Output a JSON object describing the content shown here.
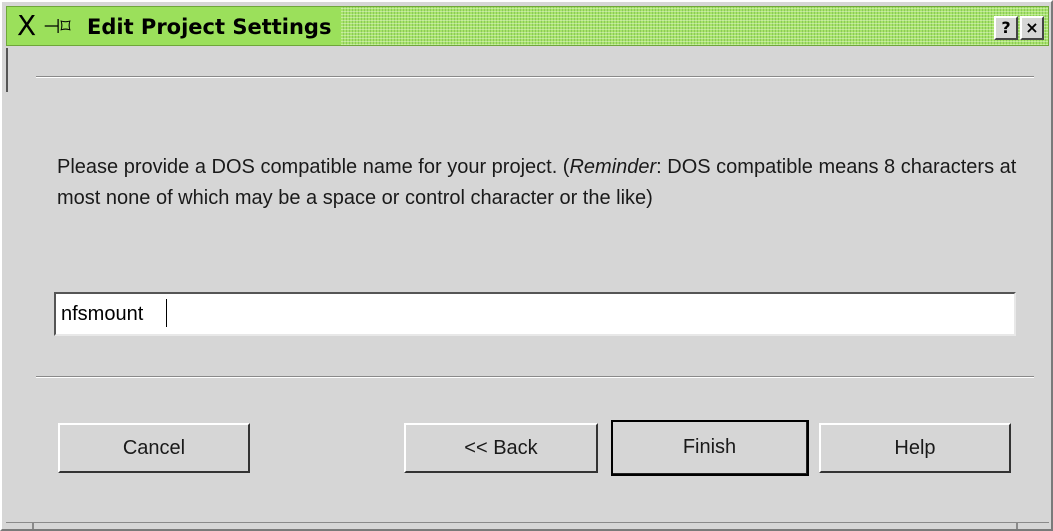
{
  "window": {
    "title": "Edit Project Settings",
    "help_button": "?",
    "close_button": "×",
    "title_icons": {
      "close_glyph": "X",
      "pin_glyph": "-⌘"
    },
    "colors": {
      "titlebar": "#a8e46a",
      "background": "#d6d6d6"
    }
  },
  "prompt": {
    "text_before": "Please provide a DOS compatible name for your project. (",
    "emphasis": "Reminder",
    "text_after": ": DOS compatible means 8 characters at most none of which may be a space or control character or the like)"
  },
  "name_input": {
    "value": "nfsmount"
  },
  "buttons": {
    "cancel": "Cancel",
    "back": "<< Back",
    "finish": "Finish",
    "help": "Help"
  }
}
